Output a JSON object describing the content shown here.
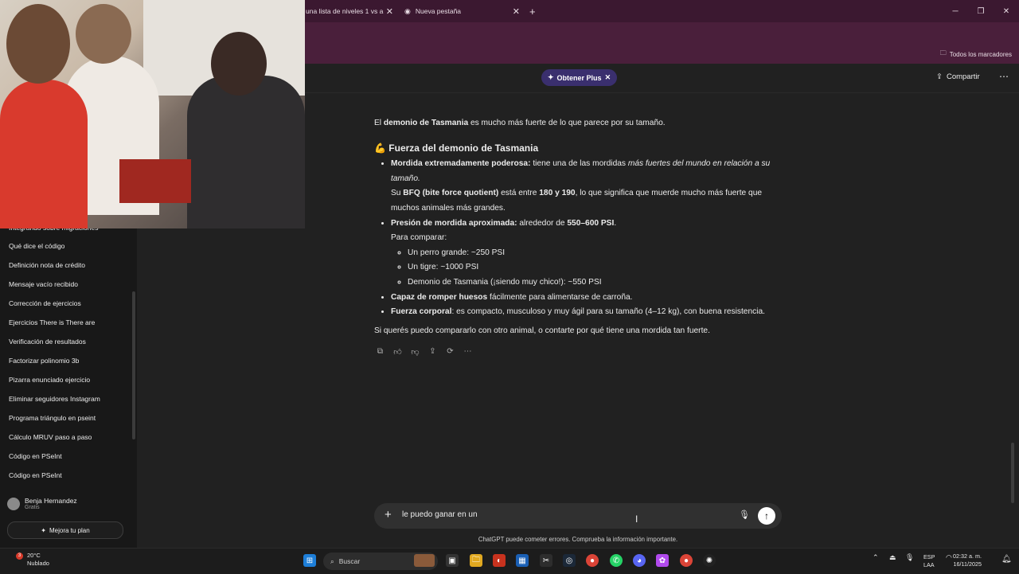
{
  "browser": {
    "tabs": [
      {
        "label": "una lista de niveles 1 vs a"
      },
      {
        "label": "Nueva pestaña"
      }
    ],
    "new_tab_icon": "plus-icon",
    "bookmarks_all": "Todos los marcadores"
  },
  "header": {
    "upgrade_pill": "Obtener Plus",
    "share": "Compartir"
  },
  "sidebar": {
    "items": [
      {
        "label": "Integrando sobre migraciones"
      },
      {
        "label": "Qué dice el código"
      },
      {
        "label": "Definición nota de crédito"
      },
      {
        "label": "Mensaje vacío recibido"
      },
      {
        "label": "Corrección de ejercicios"
      },
      {
        "label": "Ejercicios There is There are"
      },
      {
        "label": "Verificación de resultados"
      },
      {
        "label": "Factorizar polinomio 3b"
      },
      {
        "label": "Pizarra enunciado ejercicio"
      },
      {
        "label": "Eliminar seguidores Instagram"
      },
      {
        "label": "Programa triángulo en pseint"
      },
      {
        "label": "Cálculo MRUV paso a paso"
      },
      {
        "label": "Código en PSeInt"
      },
      {
        "label": "Código en PSeInt"
      }
    ],
    "user": {
      "name": "Benja Hernandez",
      "plan": "Gratis"
    },
    "upgrade": "Mejora tu plan"
  },
  "message": {
    "intro_pre": "El ",
    "intro_bold": "demonio de Tasmania",
    "intro_post": " es mucho más fuerte de lo que parece por su tamaño.",
    "heading_emoji": "💪",
    "heading": "Fuerza del demonio de Tasmania",
    "b1_bold": "Mordida extremadamente poderosa:",
    "b1_text": " tiene una de las mordidas ",
    "b1_italic": "más fuertes del mundo en relación a su tamaño.",
    "b1_l2_pre": "Su ",
    "b1_l2_bold1": "BFQ (bite force quotient)",
    "b1_l2_mid": " está entre ",
    "b1_l2_bold2": "180 y 190",
    "b1_l2_post": ", lo que significa que muerde mucho más fuerte que muchos animales más grandes.",
    "b2_bold": "Presión de mordida aproximada:",
    "b2_text": " alrededor de ",
    "b2_bold2": "550–600 PSI",
    "b2_post": ".",
    "b2_compare": "Para comparar:",
    "sub": [
      {
        "label": "Un perro grande: ~250 PSI"
      },
      {
        "label": "Un tigre: ~1000 PSI"
      },
      {
        "label": "Demonio de Tasmania (¡siendo muy chico!): ~550 PSI"
      }
    ],
    "b3_bold": "Capaz de romper huesos",
    "b3_text": " fácilmente para alimentarse de carroña.",
    "b4_bold": "Fuerza corporal",
    "b4_text": ": es compacto, musculoso y muy ágil para su tamaño (4–12 kg), con buena resistencia.",
    "outro": "Si querés puedo compararlo con otro animal, o contarte por qué tiene una mordida tan fuerte."
  },
  "composer": {
    "value": "le puedo ganar en un",
    "disclaimer": "ChatGPT puede cometer errores. Comprueba la información importante."
  },
  "taskbar": {
    "weather_temp": "20°C",
    "weather_desc": "Nublado",
    "weather_badge": "3",
    "search": "Buscar",
    "lang1": "ESP",
    "lang2": "LAA",
    "time": "02:32 a. m.",
    "date": "16/11/2025"
  },
  "colors": {
    "titlebar": "#3b1830",
    "plus_pill": "#3a2f6e",
    "background": "#212121"
  }
}
